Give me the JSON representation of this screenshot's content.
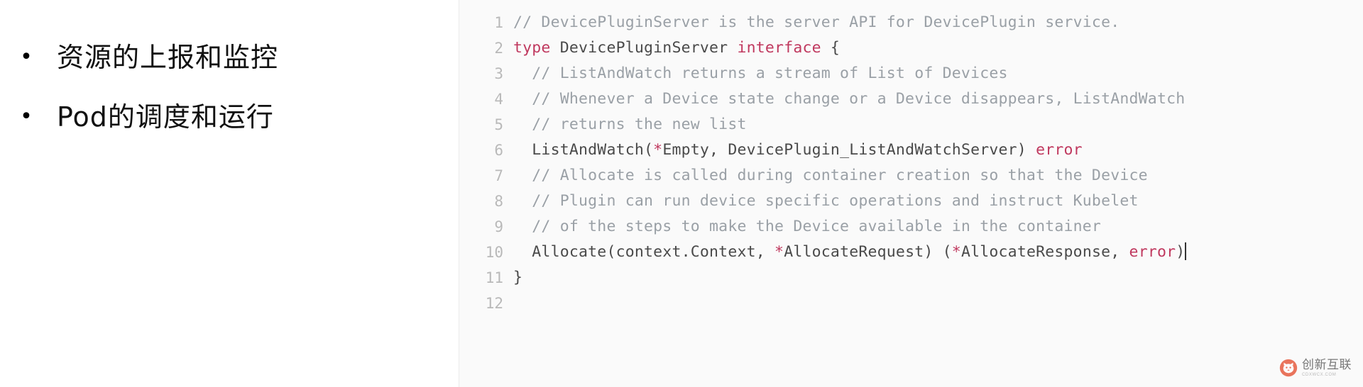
{
  "slide": {
    "background_color": "#ffffff",
    "code_background_color": "#fafafa",
    "accent_color": "#c0395f",
    "comment_color": "#9aa0a6",
    "line_number_color": "#b9b9b9"
  },
  "left": {
    "bullet_glyph": "•",
    "items": [
      {
        "text": "资源的上报和监控"
      },
      {
        "text": "Pod的调度和运行"
      }
    ]
  },
  "code": {
    "language": "go",
    "lines": [
      {
        "number": "1",
        "tokens": [
          {
            "t": "// DevicePluginServer is the server API for DevicePlugin service.",
            "c": "comment"
          }
        ]
      },
      {
        "number": "2",
        "tokens": [
          {
            "t": "type",
            "c": "keyword"
          },
          {
            "t": " DevicePluginServer ",
            "c": "plain"
          },
          {
            "t": "interface",
            "c": "keyword"
          },
          {
            "t": " {",
            "c": "punct"
          }
        ]
      },
      {
        "number": "3",
        "tokens": [
          {
            "t": "  // ListAndWatch returns a stream of List of Devices",
            "c": "comment"
          }
        ]
      },
      {
        "number": "4",
        "tokens": [
          {
            "t": "  // Whenever a Device state change or a Device disappears, ListAndWatch",
            "c": "comment"
          }
        ]
      },
      {
        "number": "5",
        "tokens": [
          {
            "t": "  // returns the new list",
            "c": "comment"
          }
        ]
      },
      {
        "number": "6",
        "tokens": [
          {
            "t": "  ListAndWatch(",
            "c": "plain"
          },
          {
            "t": "*",
            "c": "star"
          },
          {
            "t": "Empty, DevicePlugin_ListAndWatchServer) ",
            "c": "plain"
          },
          {
            "t": "error",
            "c": "keyword"
          }
        ]
      },
      {
        "number": "7",
        "tokens": [
          {
            "t": "  // Allocate is called during container creation so that the Device",
            "c": "comment"
          }
        ]
      },
      {
        "number": "8",
        "tokens": [
          {
            "t": "  // Plugin can run device specific operations and instruct Kubelet",
            "c": "comment"
          }
        ]
      },
      {
        "number": "9",
        "tokens": [
          {
            "t": "  // of the steps to make the Device available in the container",
            "c": "comment"
          }
        ]
      },
      {
        "number": "10",
        "tokens": [
          {
            "t": "  Allocate(context.Context, ",
            "c": "plain"
          },
          {
            "t": "*",
            "c": "star"
          },
          {
            "t": "AllocateRequest) (",
            "c": "plain"
          },
          {
            "t": "*",
            "c": "star"
          },
          {
            "t": "AllocateResponse, ",
            "c": "plain"
          },
          {
            "t": "error",
            "c": "keyword"
          },
          {
            "t": ")",
            "c": "punct"
          }
        ],
        "caret": true
      },
      {
        "number": "11",
        "tokens": [
          {
            "t": "}",
            "c": "punct"
          }
        ]
      },
      {
        "number": "12",
        "tokens": []
      }
    ]
  },
  "watermark": {
    "logo_name": "cat-logo-icon",
    "main_text": "创新互联",
    "sub_text": "CDXWCX.COM"
  }
}
